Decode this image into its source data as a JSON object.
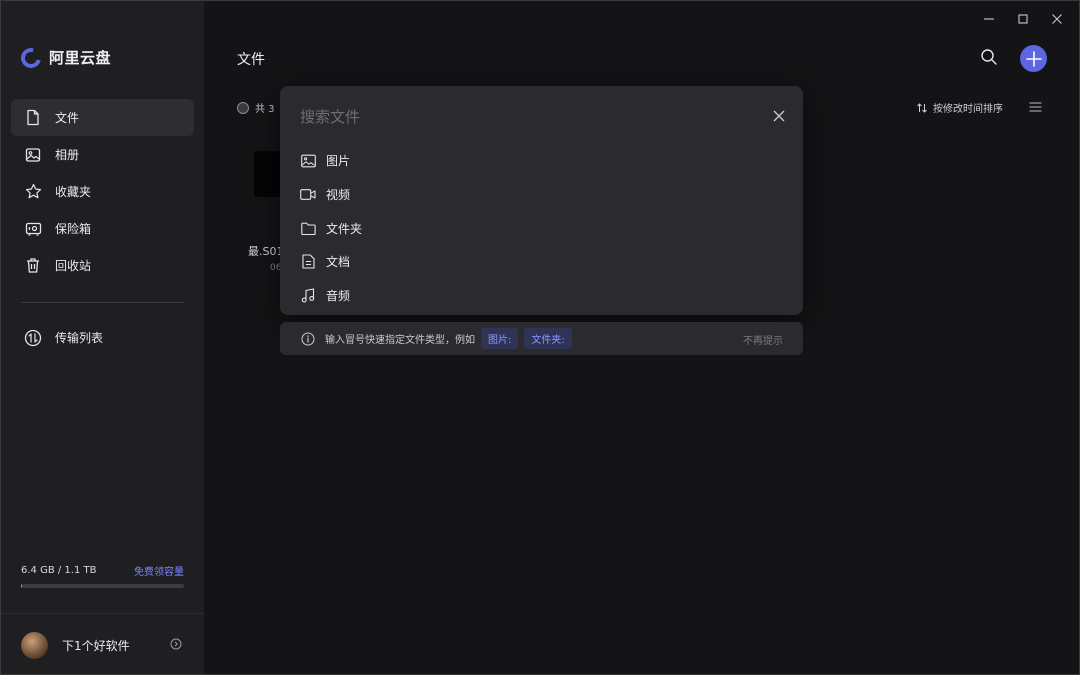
{
  "app": {
    "name": "阿里云盘"
  },
  "sidebar": {
    "items": [
      {
        "label": "文件",
        "icon": "file-icon",
        "active": true
      },
      {
        "label": "相册",
        "icon": "photo-album-icon"
      },
      {
        "label": "收藏夹",
        "icon": "star-icon"
      },
      {
        "label": "保险箱",
        "icon": "safe-icon"
      },
      {
        "label": "回收站",
        "icon": "trash-icon"
      }
    ],
    "transfer": {
      "label": "传输列表",
      "icon": "transfer-icon"
    },
    "storage": {
      "used": "6.4 GB / 1.1 TB",
      "link": "免费领容量",
      "fill_fraction": 0.006
    },
    "user": {
      "name": "下1个好软件"
    }
  },
  "main": {
    "title": "文件",
    "count_prefix": "共 3",
    "sort_label": "按修改时间排序",
    "file": {
      "name": "最.S01",
      "date": "06"
    }
  },
  "search": {
    "placeholder": "搜索文件",
    "categories": [
      {
        "label": "图片",
        "icon": "image-icon"
      },
      {
        "label": "视频",
        "icon": "video-icon"
      },
      {
        "label": "文件夹",
        "icon": "folder-icon"
      },
      {
        "label": "文档",
        "icon": "document-icon"
      },
      {
        "label": "音频",
        "icon": "music-icon"
      }
    ],
    "hint": {
      "text": "输入冒号快速指定文件类型，例如",
      "chips": [
        "图片:",
        "文件夹:"
      ],
      "dismiss": "不再提示"
    }
  },
  "colors": {
    "accent": "#5b66e0",
    "background": "#141416",
    "sidebar": "#1f1f22",
    "panel": "#2b2b2f"
  }
}
